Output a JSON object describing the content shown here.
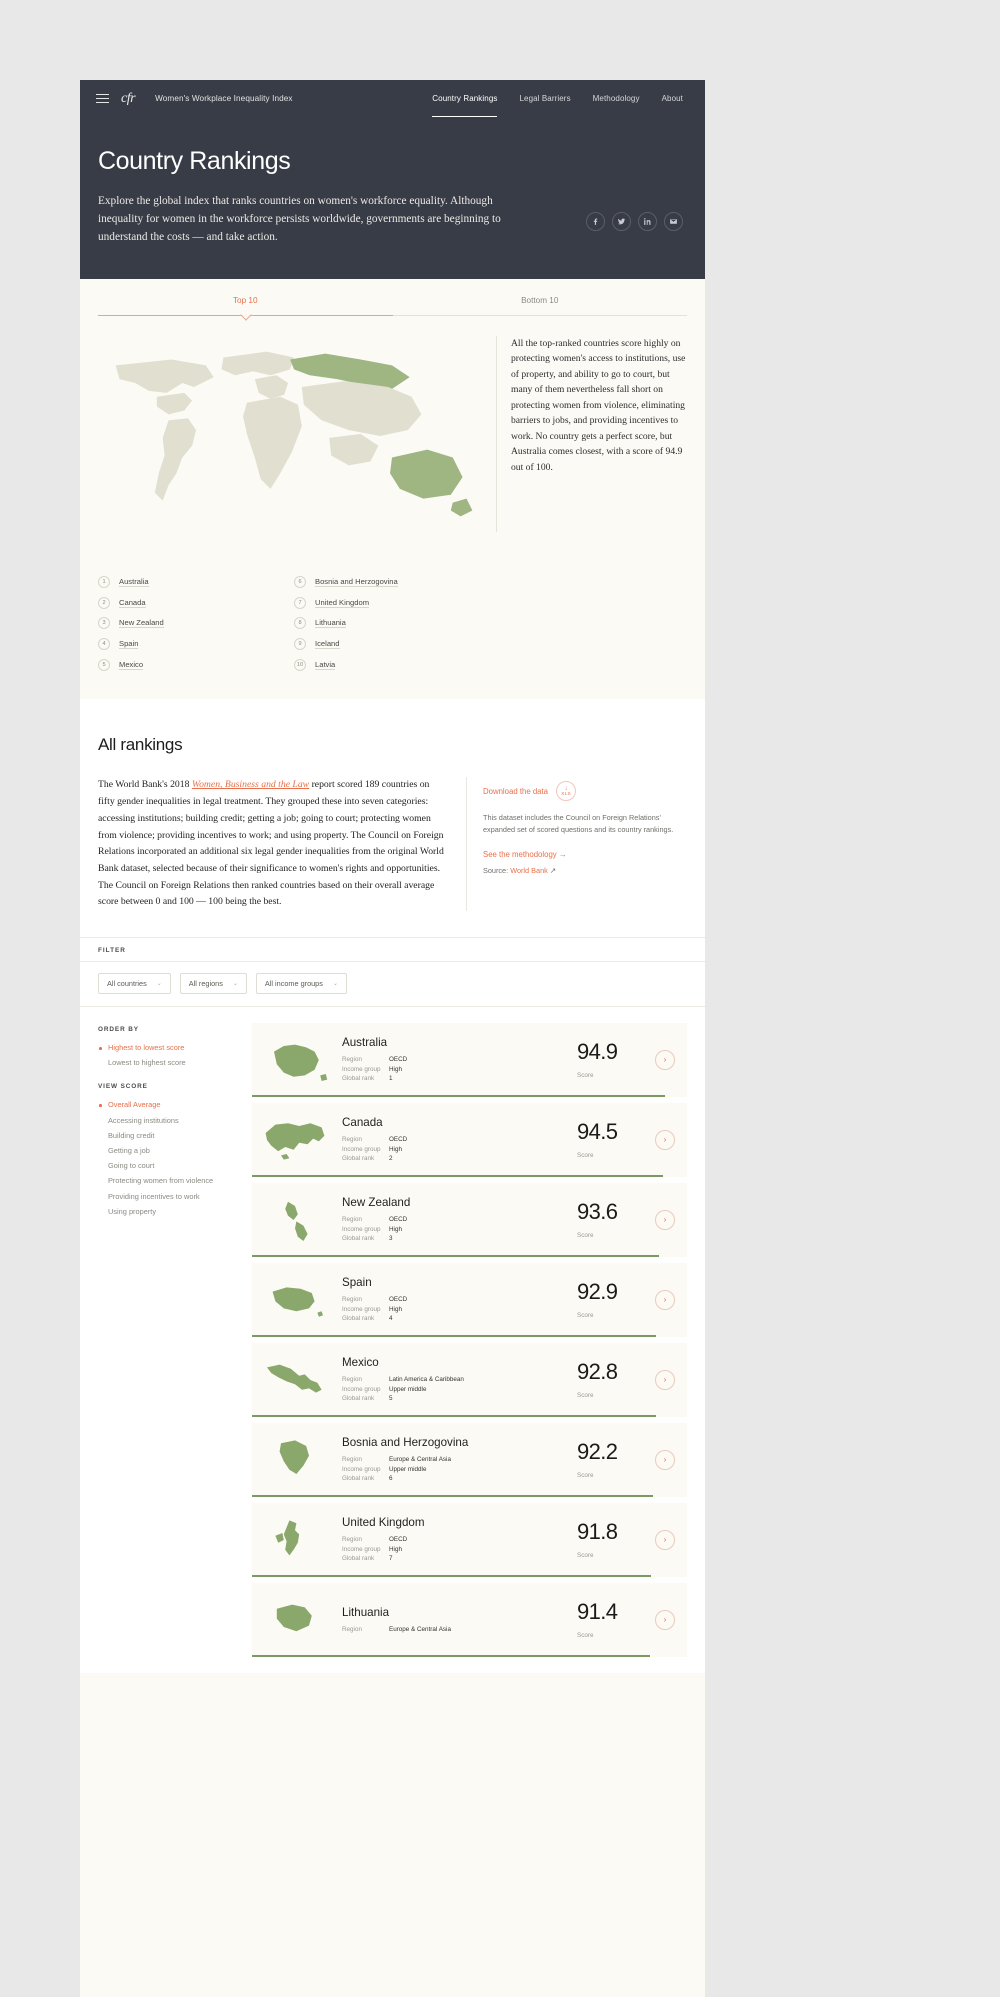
{
  "nav": {
    "logo": "cfr",
    "site_title": "Women's Workplace Inequality Index",
    "items": [
      {
        "label": "Country Rankings",
        "active": true
      },
      {
        "label": "Legal Barriers",
        "active": false
      },
      {
        "label": "Methodology",
        "active": false
      },
      {
        "label": "About",
        "active": false
      }
    ]
  },
  "hero": {
    "title": "Country Rankings",
    "description": "Explore the global index that ranks countries on women's workforce equality. Although inequality for women in the workforce persists worldwide, governments are beginning to understand the costs — and take action.",
    "social": [
      {
        "name": "facebook-icon",
        "glyph": "f"
      },
      {
        "name": "twitter-icon",
        "glyph": "t"
      },
      {
        "name": "linkedin-icon",
        "glyph": "in"
      },
      {
        "name": "email-icon",
        "glyph": "m"
      }
    ]
  },
  "tabs": [
    {
      "label": "Top 10",
      "active": true
    },
    {
      "label": "Bottom 10",
      "active": false
    }
  ],
  "summary": {
    "text": "All the top-ranked countries score highly on protecting women's access to institutions, use of property, and ability to go to court, but many of them nevertheless fall short on protecting women from violence, eliminating barriers to jobs, and providing incentives to work. No country gets a perfect score, but Australia comes closest, with a score of 94.9 out of 100."
  },
  "top10_left": [
    {
      "rank": "1",
      "name": "Australia"
    },
    {
      "rank": "2",
      "name": "Canada"
    },
    {
      "rank": "3",
      "name": "New Zealand"
    },
    {
      "rank": "4",
      "name": "Spain"
    },
    {
      "rank": "5",
      "name": "Mexico"
    }
  ],
  "top10_right": [
    {
      "rank": "6",
      "name": "Bosnia and Herzogovina"
    },
    {
      "rank": "7",
      "name": "United Kingdom"
    },
    {
      "rank": "8",
      "name": "Lithuania"
    },
    {
      "rank": "9",
      "name": "Iceland"
    },
    {
      "rank": "10",
      "name": "Latvia"
    }
  ],
  "allrank": {
    "heading": "All rankings",
    "para_before": "The World Bank's 2018 ",
    "para_link": "Women, Business and the Law",
    "para_after": " report scored 189 countries on fifty gender inequalities in legal treatment. They grouped these into seven categories: accessing institutions; building credit; getting a job; going to court; protecting women from violence; providing incentives to work; and using property. The Council on Foreign Relations incorporated an additional six legal gender inequalities from the original World Bank dataset, selected because of their significance to women's rights and opportunities. The Council on Foreign Relations then ranked countries based on their overall average score between 0 and 100 — 100 being the best.",
    "download_label": "Download the data",
    "download_badge_arrow": "↓",
    "download_badge_label": "XLS",
    "download_desc": "This dataset includes the Council on Foreign Relations' expanded set of scored questions and its country rankings.",
    "methodology_link": "See the methodology →",
    "source_prefix": "Source: ",
    "source_link": "World Bank",
    "source_external_icon": "↗"
  },
  "filter": {
    "label": "FILTER",
    "selects": [
      {
        "name": "countries-select",
        "value": "All countries",
        "chevron": "⌄"
      },
      {
        "name": "regions-select",
        "value": "All regions",
        "chevron": "⌄"
      },
      {
        "name": "income-select",
        "value": "All income groups",
        "chevron": "⌄"
      }
    ]
  },
  "sidebar": {
    "order_by_heading": "ORDER BY",
    "order_by": [
      {
        "label": "Highest to lowest score",
        "selected": true
      },
      {
        "label": "Lowest to highest score",
        "selected": false
      }
    ],
    "view_score_heading": "VIEW SCORE",
    "view_score": [
      {
        "label": "Overall Average",
        "selected": true
      },
      {
        "label": "Accessing institutions",
        "selected": false
      },
      {
        "label": "Building credit",
        "selected": false
      },
      {
        "label": "Getting a job",
        "selected": false
      },
      {
        "label": "Going to court",
        "selected": false
      },
      {
        "label": "Protecting women from violence",
        "selected": false
      },
      {
        "label": "Providing incentives to work",
        "selected": false
      },
      {
        "label": "Using property",
        "selected": false
      }
    ]
  },
  "card_labels": {
    "region": "Region",
    "income_group": "Income group",
    "global_rank": "Global rank",
    "score": "Score",
    "arrow": "›"
  },
  "chart_data": {
    "type": "bar",
    "title": "All rankings — Overall Average score",
    "xlabel": "",
    "ylabel": "Score",
    "ylim": [
      0,
      100
    ],
    "categories": [
      "Australia",
      "Canada",
      "New Zealand",
      "Spain",
      "Mexico",
      "Bosnia and Herzogovina",
      "United Kingdom",
      "Lithuania"
    ],
    "values": [
      94.9,
      94.5,
      93.6,
      92.9,
      92.8,
      92.2,
      91.8,
      91.4
    ]
  },
  "cards": [
    {
      "country": "Australia",
      "region": "OECD",
      "income_group": "High",
      "global_rank": "1",
      "score": "94.9",
      "bar_pct": 94.9,
      "map": "australia"
    },
    {
      "country": "Canada",
      "region": "OECD",
      "income_group": "High",
      "global_rank": "2",
      "score": "94.5",
      "bar_pct": 94.5,
      "map": "canada"
    },
    {
      "country": "New Zealand",
      "region": "OECD",
      "income_group": "High",
      "global_rank": "3",
      "score": "93.6",
      "bar_pct": 93.6,
      "map": "newzealand"
    },
    {
      "country": "Spain",
      "region": "OECD",
      "income_group": "High",
      "global_rank": "4",
      "score": "92.9",
      "bar_pct": 92.9,
      "map": "spain"
    },
    {
      "country": "Mexico",
      "region": "Latin America & Caribbean",
      "income_group": "Upper middle",
      "global_rank": "5",
      "score": "92.8",
      "bar_pct": 92.8,
      "map": "mexico"
    },
    {
      "country": "Bosnia and Herzogovina",
      "region": "Europe & Central Asia",
      "income_group": "Upper middle",
      "global_rank": "6",
      "score": "92.2",
      "bar_pct": 92.2,
      "map": "bosnia"
    },
    {
      "country": "United Kingdom",
      "region": "OECD",
      "income_group": "High",
      "global_rank": "7",
      "score": "91.8",
      "bar_pct": 91.8,
      "map": "uk"
    },
    {
      "country": "Lithuania",
      "region": "Europe & Central Asia",
      "income_group": "",
      "global_rank": "",
      "score": "91.4",
      "bar_pct": 91.4,
      "map": "lithuania"
    }
  ]
}
